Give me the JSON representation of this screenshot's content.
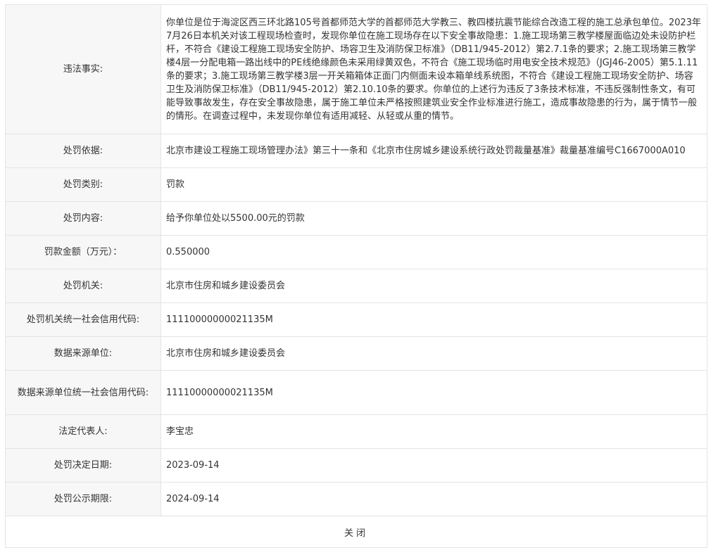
{
  "rows": [
    {
      "label": "违法事实:",
      "value": "你单位是位于海淀区西三环北路105号首都师范大学的首都师范大学教三、教四楼抗震节能综合改造工程的施工总承包单位。2023年7月26日本机关对该工程现场检查时，发现你单位在施工现场存在以下安全事故隐患：1.施工现场第三教学楼屋面临边处未设防护栏杆，不符合《建设工程施工现场安全防护、场容卫生及消防保卫标准》（DB11/945-2012）第2.7.1条的要求；2.施工现场第三教学楼4层一分配电箱一路出线中的PE线绝缘颜色未采用绿黄双色，不符合《施工现场临时用电安全技术规范》（JGJ46-2005）第5.1.11条的要求；3.施工现场第三教学楼3层一开关箱箱体正面门内侧面未设本箱单线系统图，不符合《建设工程施工现场安全防护、场容卫生及消防保卫标准》（DB11/945-2012）第2.10.10条的要求。你单位的上述行为违反了3条技术标准，不违反强制性条文，有可能导致事故发生，存在安全事故隐患，属于施工单位未严格按照建筑业安全作业标准进行施工，造成事故隐患的行为，属于情节一般的情形。在调查过程中，未发现你单位有适用减轻、从轻或从重的情节。"
    },
    {
      "label": "处罚依据:",
      "value": "北京市建设工程施工现场管理办法》第三十一条和《北京市住房城乡建设系统行政处罚裁量基准》裁量基准编号C1667000A010"
    },
    {
      "label": "处罚类别:",
      "value": "罚款"
    },
    {
      "label": "处罚内容:",
      "value": "给予你单位处以5500.00元的罚款"
    },
    {
      "label": "罚款金额（万元）：",
      "value": "0.550000"
    },
    {
      "label": "处罚机关:",
      "value": "北京市住房和城乡建设委员会"
    },
    {
      "label": "处罚机关统一社会信用代码:",
      "value": "11110000000021135M"
    },
    {
      "label": "数据来源单位:",
      "value": "北京市住房和城乡建设委员会"
    },
    {
      "label": "数据来源单位统一社会信用代码:",
      "value": "11110000000021135M"
    },
    {
      "label": "法定代表人:",
      "value": "李宝忠"
    },
    {
      "label": "处罚决定日期:",
      "value": "2023-09-14"
    },
    {
      "label": "处罚公示期限:",
      "value": "2024-09-14"
    }
  ],
  "footer": {
    "close_label": "关闭"
  }
}
